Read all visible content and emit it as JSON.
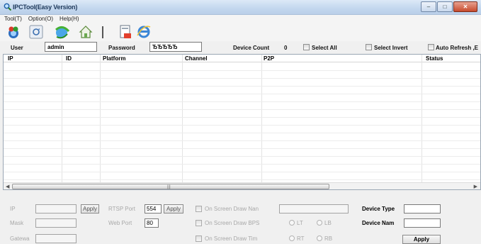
{
  "window": {
    "title": "IPCTool(Easy Version)",
    "controls": [
      "minimize",
      "maximize",
      "close"
    ]
  },
  "menu": [
    "Tool(T)",
    "Option(O)",
    "Help(H)"
  ],
  "toolbar": {
    "icons": [
      "search-device-icon",
      "refresh-icon",
      "ie-browser-icon",
      "home-icon",
      "settings-document-icon",
      "internet-explorer-icon"
    ]
  },
  "login": {
    "user_label": "User",
    "user_value": "admin",
    "password_label": "Password",
    "password_value": "ЂЂЂЂЂ",
    "device_count_label": "Device Count",
    "device_count_value": "0",
    "select_all_label": "Select All",
    "select_invert_label": "Select Invert",
    "auto_refresh_label": "Auto Refresh ,E"
  },
  "grid": {
    "columns": [
      "IP",
      "ID",
      "Platform",
      "Channel",
      "P2P",
      "Status"
    ],
    "rows": []
  },
  "settings": {
    "ip_label": "IP",
    "ip_value": "",
    "mask_label": "Mask",
    "mask_value": "",
    "gateway_label": "Gatewa",
    "gateway_value": "",
    "apply_label": "Apply",
    "rtsp_port_label": "RTSP Port",
    "rtsp_port_value": "554",
    "rtsp_apply_label": "Apply",
    "web_port_label": "Web Port",
    "web_port_value": "80",
    "osd_name_label": "On Screen Draw Nan",
    "osd_name_value": "",
    "osd_bps_label": "On Screen Draw BPS",
    "osd_time_label": "On Screen Draw Tim",
    "radio_lt": "LT",
    "radio_lb": "LB",
    "radio_rt": "RT",
    "radio_rb": "RB",
    "device_type_label": "Device Type",
    "device_type_value": "",
    "device_name_label": "Device Nam",
    "device_name_value": "",
    "device_apply_label": "Apply"
  }
}
